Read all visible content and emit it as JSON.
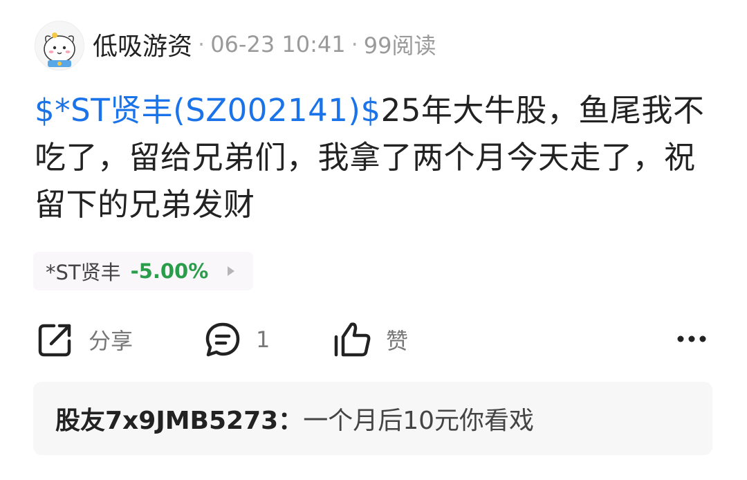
{
  "post": {
    "author": "低吸游资",
    "date": "06-23 10:41",
    "views": "99阅读",
    "stock_tag": "$*ST贤丰(SZ002141)$",
    "content": "25年大牛股，鱼尾我不吃了，留给兄弟们，我拿了两个月今天走了，祝留下的兄弟发财"
  },
  "stock_chip": {
    "name": "*ST贤丰",
    "change": "-5.00%",
    "color_down": "#2a9d4a"
  },
  "actions": {
    "share_label": "分享",
    "comment_count": "1",
    "like_label": "赞"
  },
  "comment": {
    "user": "股友7x9JMB5273：",
    "text": "一个月后10元你看戏"
  },
  "colors": {
    "link": "#1a73e8",
    "text": "#222222",
    "meta": "#9a9a9a"
  }
}
